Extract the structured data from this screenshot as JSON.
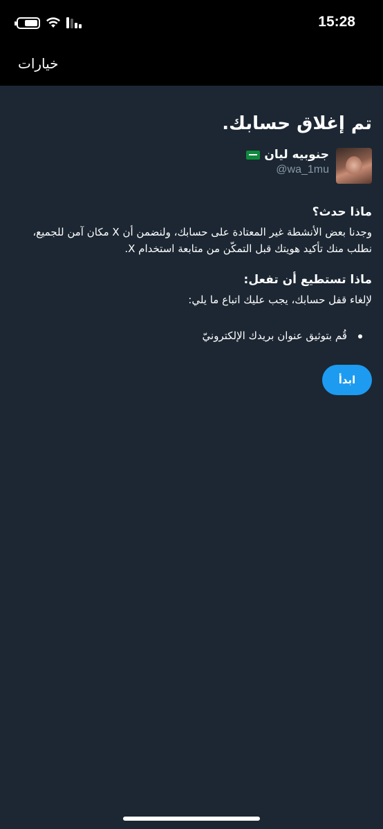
{
  "status_bar": {
    "time": "15:28"
  },
  "nav": {
    "options_label": "خيارات"
  },
  "page": {
    "title": "تم إغلاق حسابك.",
    "account": {
      "display_name": "جنوبيه ليان",
      "flag": "saudi-flag-icon",
      "handle": "@wa_1mu"
    },
    "what_happened": {
      "heading": "ماذا حدث؟",
      "body": "وجدنا بعض الأنشطة غير المعتادة على حسابك، ولنضمن أن X مكان آمن للجميع، نطلب منك تأكيد هويتك قبل التمكّن من متابعة استخدام X."
    },
    "what_you_can_do": {
      "heading": "ماذا تستطيع أن تفعل:",
      "body": "لإلغاء قفل حسابك، يجب عليك اتباع ما يلي:",
      "steps": [
        "قُم بتوثيق عنوان بريدك الإلكترونيّ"
      ]
    },
    "start_button_label": "ابدأ"
  },
  "colors": {
    "background": "#1c2733",
    "bars": "#000000",
    "accent": "#1d9bf0",
    "secondary_text": "#8899a6"
  }
}
